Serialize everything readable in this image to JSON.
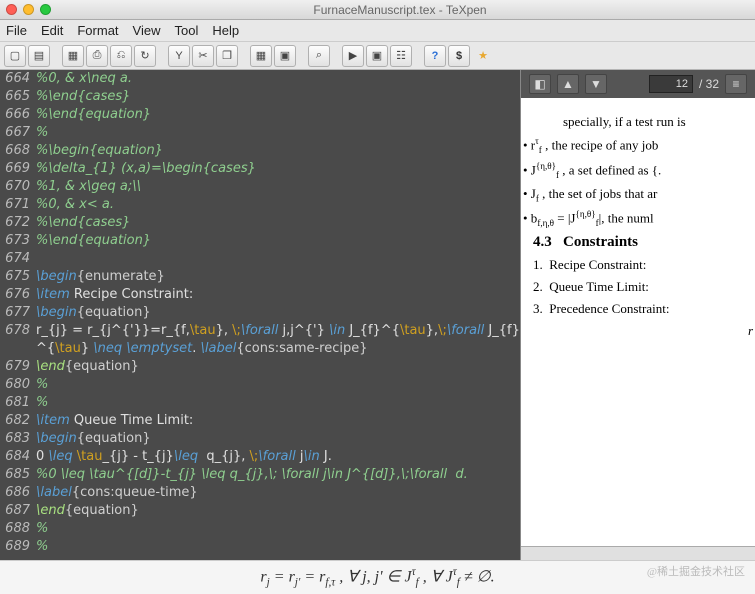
{
  "window": {
    "title": "FurnaceManuscript.tex - TeXpen"
  },
  "menu": {
    "items": [
      "File",
      "Edit",
      "Format",
      "View",
      "Tool",
      "Help"
    ]
  },
  "toolbar": {
    "icons": [
      "new",
      "open",
      "save",
      "print",
      "undo",
      "redo",
      "cut",
      "copy",
      "paste",
      "bold",
      "grid",
      "image",
      "zoom",
      "run",
      "stop",
      "find",
      "help",
      "money",
      "star"
    ]
  },
  "editor": {
    "lines": [
      {
        "n": 664,
        "t": "comment",
        "txt": "%0, & x\\neq a."
      },
      {
        "n": 665,
        "t": "comment",
        "txt": "%\\end{cases}"
      },
      {
        "n": 666,
        "t": "comment",
        "txt": "%\\end{equation}"
      },
      {
        "n": 667,
        "t": "comment",
        "txt": "%"
      },
      {
        "n": 668,
        "t": "comment",
        "txt": "%\\begin{equation}"
      },
      {
        "n": 669,
        "t": "comment",
        "txt": "%\\delta_{1} (x,a)=\\begin{cases}"
      },
      {
        "n": 670,
        "t": "comment",
        "txt": "%1, & x\\geq a;\\\\"
      },
      {
        "n": 671,
        "t": "comment",
        "txt": "%0, & x< a."
      },
      {
        "n": 672,
        "t": "comment",
        "txt": "%\\end{cases}"
      },
      {
        "n": 673,
        "t": "comment",
        "txt": "%\\end{equation}"
      },
      {
        "n": 674,
        "t": "blank",
        "txt": ""
      },
      {
        "n": 675,
        "t": "begin",
        "arg": "enumerate"
      },
      {
        "n": 676,
        "t": "item",
        "txt": "Recipe Constraint:"
      },
      {
        "n": 677,
        "t": "begin",
        "arg": "equation"
      },
      {
        "n": 678,
        "t": "rawA"
      },
      {
        "n": 679,
        "t": "end",
        "arg": "equation"
      },
      {
        "n": 680,
        "t": "comment",
        "txt": "%"
      },
      {
        "n": 681,
        "t": "comment",
        "txt": "%"
      },
      {
        "n": 682,
        "t": "item",
        "txt": "Queue Time Limit:"
      },
      {
        "n": 683,
        "t": "begin",
        "arg": "equation"
      },
      {
        "n": 684,
        "t": "rawB"
      },
      {
        "n": 685,
        "t": "comment",
        "txt": "%0 \\leq \\tau^{[d]}-t_{j} \\leq q_{j},\\; \\forall j\\in J^{[d]},\\;\\forall  d."
      },
      {
        "n": 686,
        "t": "label",
        "arg": "cons:queue-time"
      },
      {
        "n": 687,
        "t": "end",
        "arg": "equation"
      },
      {
        "n": 688,
        "t": "comment",
        "txt": "%"
      },
      {
        "n": 689,
        "t": "comment",
        "txt": "%"
      }
    ],
    "rawA": {
      "p1": "r_{j} = r_{j^{'}}=r_{f,",
      "tau": "\\tau",
      "p2": "}, ",
      "bs": "\\;",
      "fa": "\\forall",
      "p3": " j,j^{'} ",
      "in": "\\in",
      "p4": " J_{f}^{",
      "p5": "},",
      "p6": " J_{f}^{",
      "neq": "\\neq ",
      "emp": "\\emptyset",
      "dot": ". ",
      "lbl": "\\label",
      "larg": "{cons:same-recipe}"
    },
    "rawB": {
      "p1": "0 ",
      "leq": "\\leq ",
      "tau": "\\tau",
      "p2": "_{j} - t_{j}",
      "p3": " q_{j}, ",
      "bs": "\\;",
      "fa": "\\forall",
      "p4": " j",
      "in": "\\in",
      "p5": " J."
    }
  },
  "preview": {
    "page": "12",
    "total": "/ 32",
    "intro": "specially, if a test run is",
    "bullets": [
      "r<sup>τ</sup><sub>f</sub> , the recipe of any job",
      "J<sup>{η,θ}</sup><sub>f</sub> , a set defined as {.",
      "J<sub>f</sub> , the set of jobs that ar",
      "b<sub>f,η,θ</sub> = |J<sup>{η,θ}</sup><sub>f</sub>|, the numl"
    ],
    "section_num": "4.3",
    "section_title": "Constraints",
    "items": [
      "Recipe Constraint:",
      "Queue Time Limit:",
      "Precedence Constraint:"
    ]
  },
  "formula": "r<sub>j</sub> = r<sub>j'</sub> = r<sub>f,τ</sub> ,  ∀ j, j' ∈ J<sup>τ</sup><sub>f</sub> ,  ∀ J<sup>τ</sup><sub>f</sub> ≠ ∅.",
  "watermark": "@稀土掘金技术社区"
}
